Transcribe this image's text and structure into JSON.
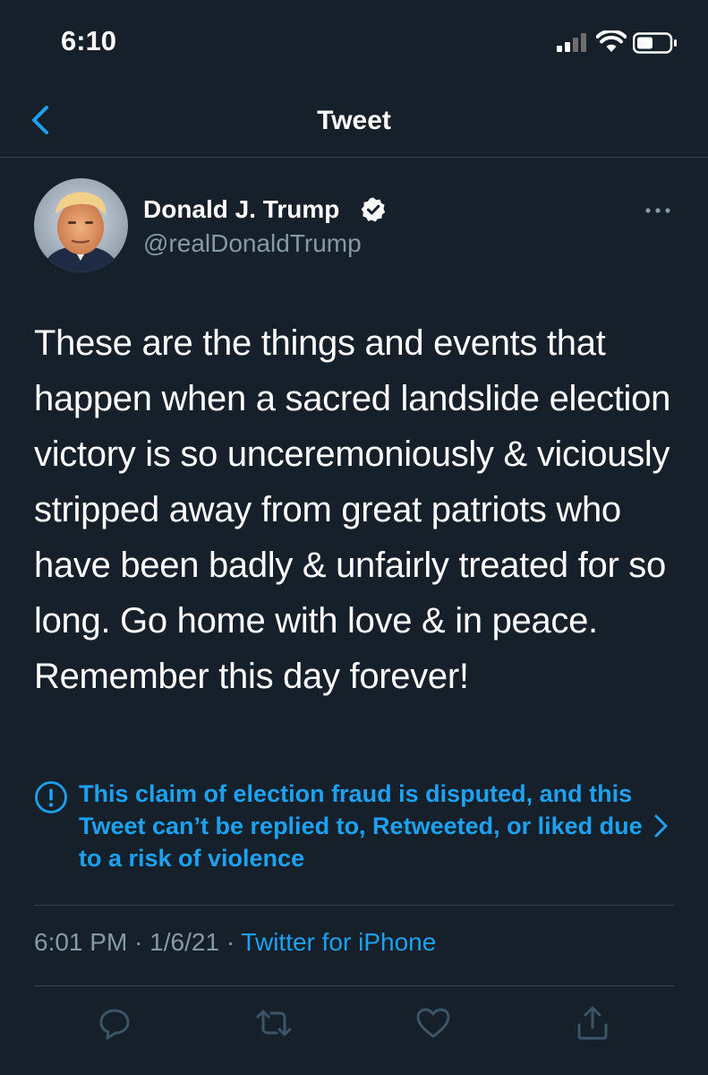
{
  "status_bar": {
    "time": "6:10"
  },
  "nav": {
    "title": "Tweet",
    "back_icon": "chevron-left-icon"
  },
  "tweet": {
    "author_name": "Donald J. Trump",
    "author_handle": "@realDonaldTrump",
    "verified": true,
    "text": "These are the things and events that happen when a sacred landslide election victory is so unceremoniously & viciously stripped away from great patriots who have been badly & unfairly treated for so long. Go home with love & in peace. Remember this day forever!",
    "notice": "This claim of election fraud is disputed, and this Tweet can’t be replied to, Retweeted, or liked due to a risk of violence",
    "time": "6:01 PM",
    "date": "1/6/21",
    "separator": "·",
    "source": "Twitter for iPhone"
  },
  "actions": [
    "reply-icon",
    "retweet-icon",
    "like-icon",
    "share-icon"
  ],
  "colors": {
    "background": "#15202b",
    "accent": "#1da1f2",
    "secondary_text": "#8899a6",
    "divider": "#38444d",
    "action_icon": "#3d5466"
  }
}
